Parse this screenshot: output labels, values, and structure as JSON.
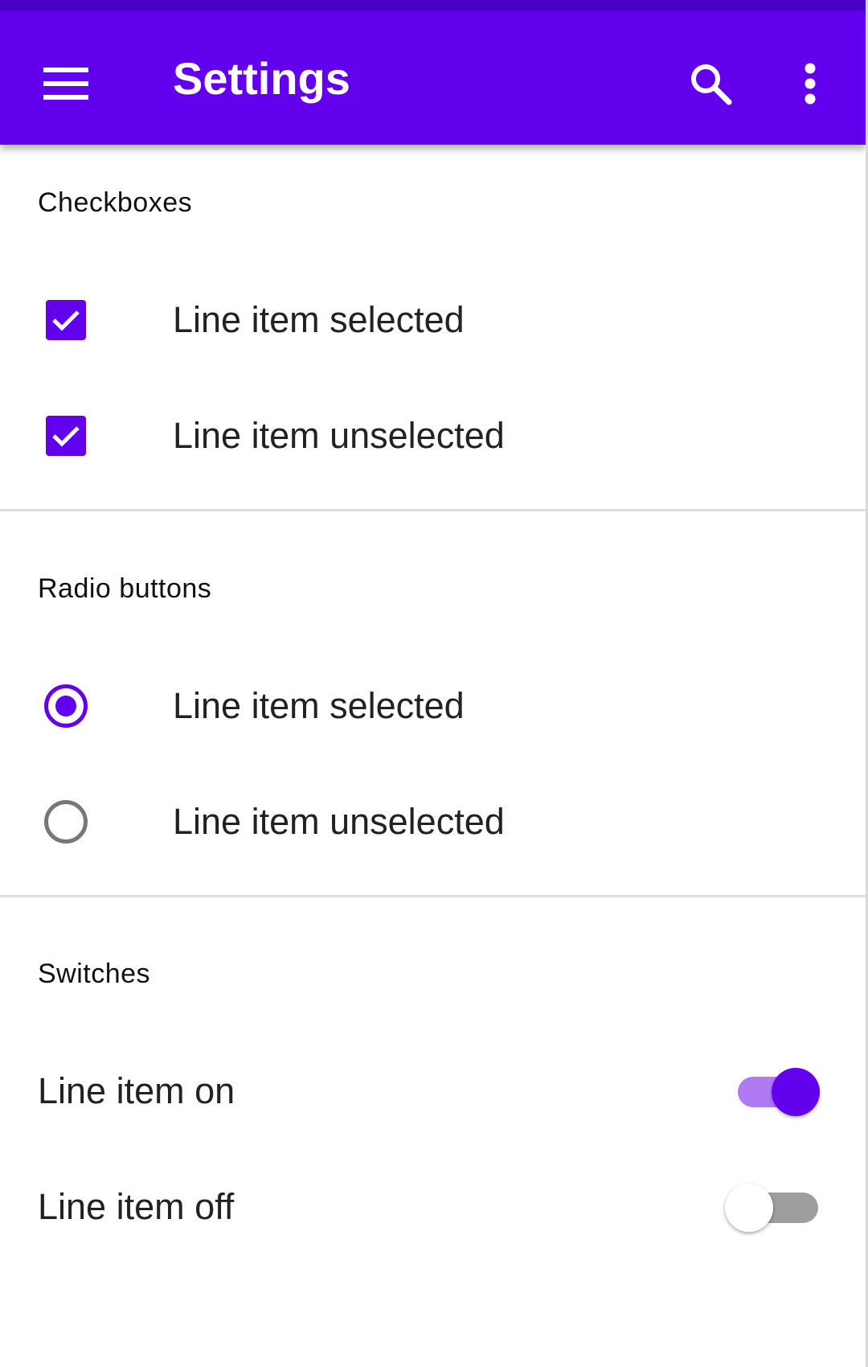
{
  "colors": {
    "primary": "#6200ee",
    "status_bar": "#4a00c8",
    "switch_track_on": "#b07af2",
    "switch_track_off": "#9e9e9e",
    "radio_unselected": "#777777"
  },
  "appbar": {
    "title": "Settings",
    "nav_icon": "hamburger-menu-icon",
    "actions": [
      "search-icon",
      "more-vert-icon"
    ]
  },
  "sections": {
    "checkboxes": {
      "header": "Checkboxes",
      "items": [
        {
          "label": "Line item selected",
          "checked": true
        },
        {
          "label": "Line item unselected",
          "checked": true
        }
      ]
    },
    "radios": {
      "header": "Radio buttons",
      "items": [
        {
          "label": "Line item selected",
          "selected": true
        },
        {
          "label": "Line item unselected",
          "selected": false
        }
      ]
    },
    "switches": {
      "header": "Switches",
      "items": [
        {
          "label": "Line item on",
          "on": true
        },
        {
          "label": "Line item off",
          "on": false
        }
      ]
    }
  }
}
